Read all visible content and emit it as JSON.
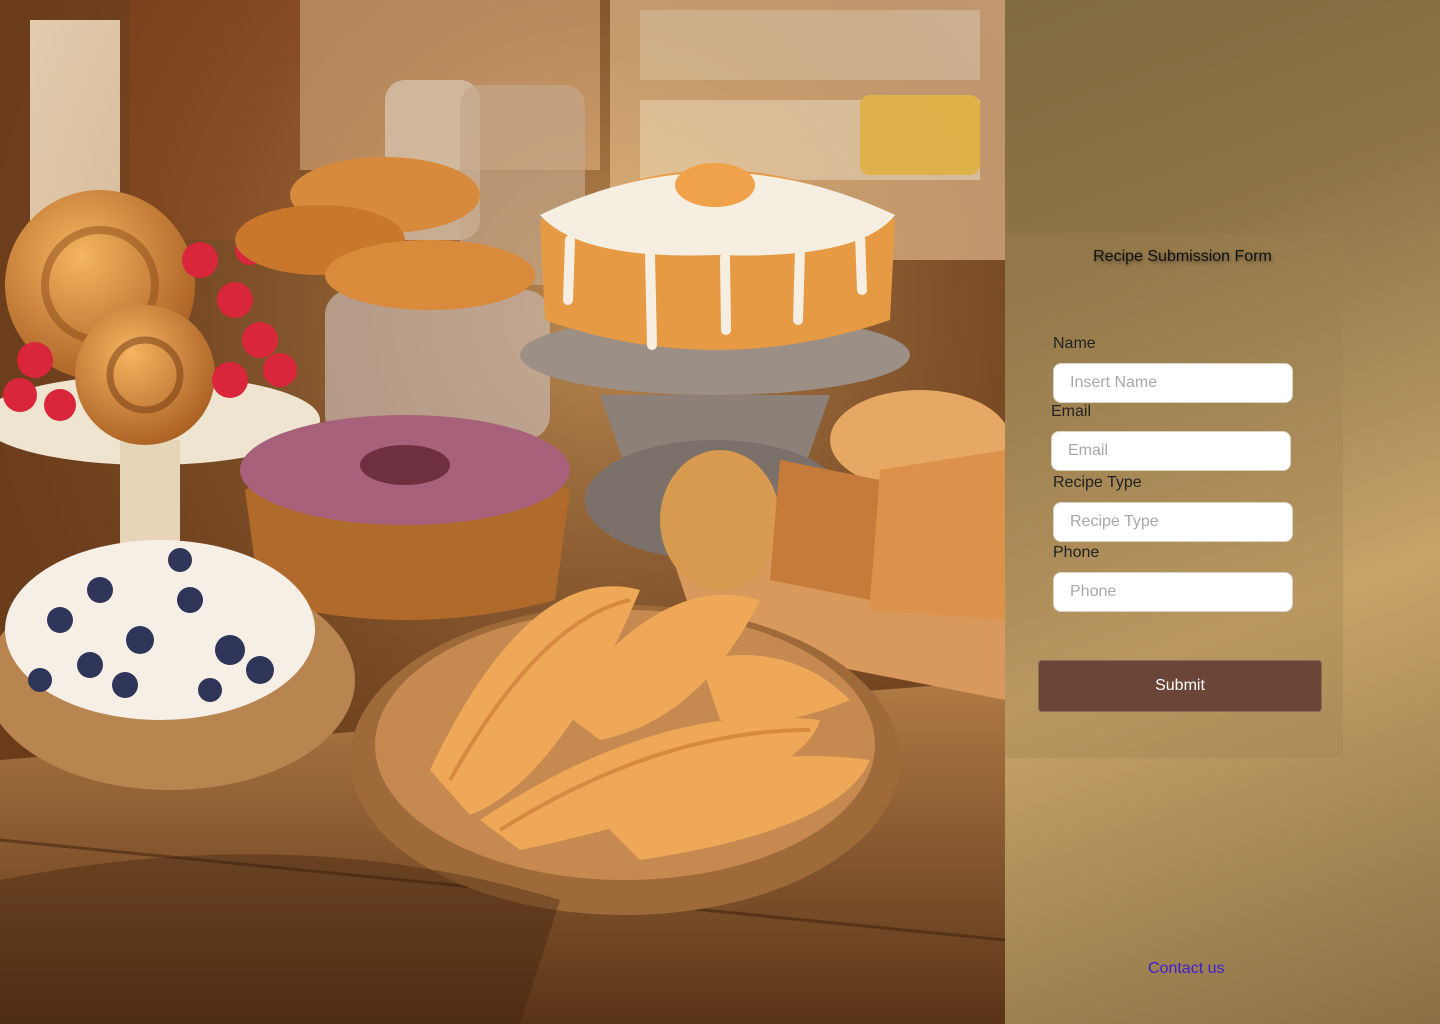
{
  "hero": {
    "image": "bakery-pastries-illustration"
  },
  "form": {
    "title": "Recipe Submission Form",
    "fields": [
      {
        "label": "Name",
        "placeholder": "Insert Name",
        "value": ""
      },
      {
        "label": "Email",
        "placeholder": "Email",
        "value": ""
      },
      {
        "label": "Recipe Type",
        "placeholder": "Recipe Type",
        "value": ""
      },
      {
        "label": "Phone",
        "placeholder": "Phone",
        "value": ""
      }
    ],
    "submit_label": "Submit"
  },
  "footer": {
    "contact_label": "Contact us"
  },
  "colors": {
    "panel": "#b59560",
    "submit": "#6b4537",
    "link": "#3b1fd4"
  }
}
